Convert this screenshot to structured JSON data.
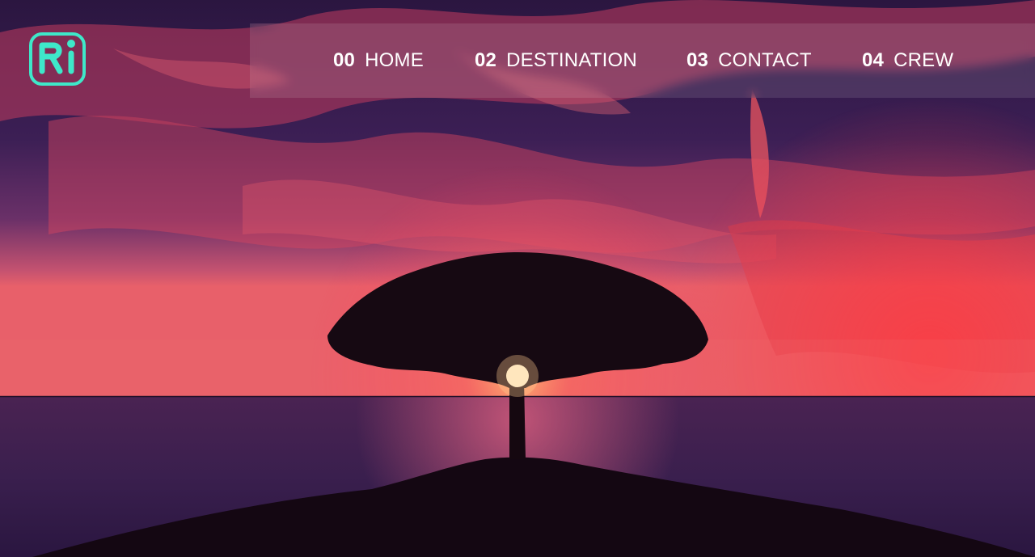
{
  "brand": {
    "logo_text": "Ri",
    "logo_color": "#3ee8c9"
  },
  "nav": {
    "items": [
      {
        "num": "00",
        "label": "HOME"
      },
      {
        "num": "02",
        "label": "DESTINATION"
      },
      {
        "num": "03",
        "label": "CONTACT"
      },
      {
        "num": "04",
        "label": "CREW"
      }
    ]
  },
  "colors": {
    "nav_text": "#ffffff",
    "sky_top": "#2a1842",
    "cloud": "#e0405c",
    "sea": "#3a2050"
  },
  "hero": {
    "image": "sunset-tree-landscape"
  }
}
